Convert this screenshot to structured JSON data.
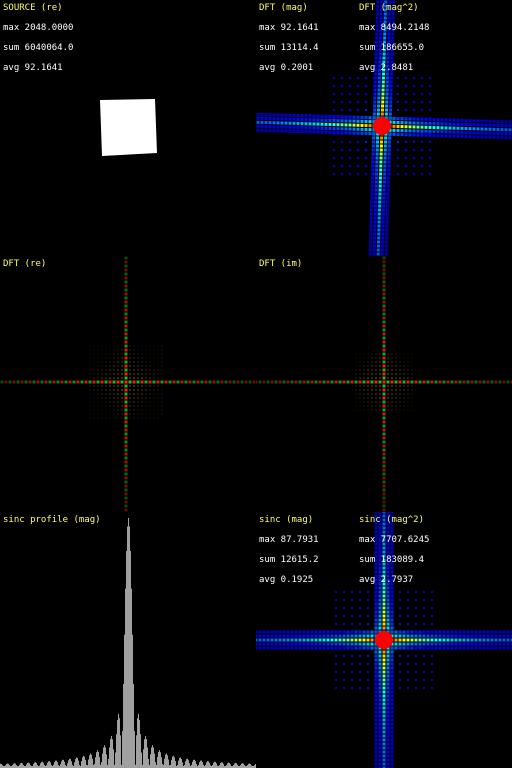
{
  "panels": {
    "source": {
      "title": "SOURCE (re)",
      "max": "max 2048.0000",
      "sum": "sum 6040064.0",
      "avg": "avg 92.1641"
    },
    "dft_mag": {
      "title": "DFT (mag)",
      "max": "max 92.1641",
      "sum": "sum 13114.4",
      "avg": "avg 0.2001",
      "title2": "DFT (mag^2)",
      "max2": "max 8494.2148",
      "sum2": "sum 186655.0",
      "avg2": "avg 2.8481"
    },
    "dft_re": {
      "title": "DFT (re)"
    },
    "dft_im": {
      "title": "DFT (im)"
    },
    "sinc_profile": {
      "title": "sinc profile (mag)"
    },
    "sinc_mag": {
      "title": "sinc (mag)",
      "max": "max 87.7931",
      "sum": "sum 12615.2",
      "avg": "avg 0.1925",
      "title2": "sinc (mag^2)",
      "max2": "max 7707.6245",
      "sum2": "sum 183089.4",
      "avg2": "avg 2.7937"
    }
  },
  "colors": {
    "label": "#ffff66",
    "stats": "#ffffff",
    "real_pos": "#ff2020",
    "real_neg": "#20c020",
    "heat_low": "#0000a0",
    "heat_high": "#ff0000",
    "profile": "#a0a0a0"
  }
}
